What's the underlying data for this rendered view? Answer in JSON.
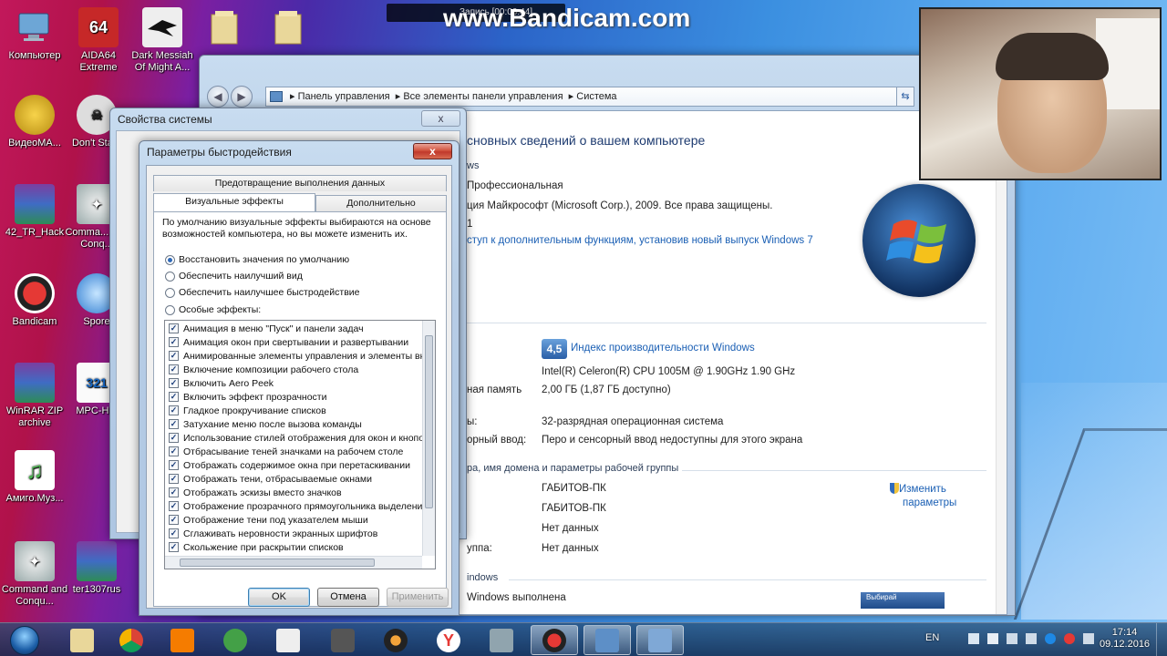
{
  "recorder": {
    "watermark": "www.Bandicam.com",
    "toolbar_text": "Запись [00:00:44]"
  },
  "desktop": {
    "icons": [
      {
        "label": "Компьютер",
        "icon": "computer-icon"
      },
      {
        "label": "AIDA64 Extreme",
        "icon": "aida64-icon"
      },
      {
        "label": "Dark Messiah Of Might A...",
        "icon": "dark-messiah-icon"
      },
      {
        "label": "",
        "icon": "folder-icon"
      },
      {
        "label": "",
        "icon": "folder-icon"
      },
      {
        "label": "ВидеоМА...",
        "icon": "videomaster-icon"
      },
      {
        "label": "Don't Sta...",
        "icon": "dont-starve-icon"
      },
      {
        "label": "42_TR_Hack",
        "icon": "winrar-icon"
      },
      {
        "label": "Comma... and Conq...",
        "icon": "command-conquer-icon"
      },
      {
        "label": "Bandicam",
        "icon": "bandicam-icon"
      },
      {
        "label": "Spore",
        "icon": "spore-icon"
      },
      {
        "label": "WinRAR ZIP archive",
        "icon": "winrar-zip-icon"
      },
      {
        "label": "MPC-H...",
        "icon": "mpc-icon"
      },
      {
        "label": "Амиго.Муз...",
        "icon": "amigo-music-icon"
      },
      {
        "label": "Command and Conqu...",
        "icon": "command-conquer-icon"
      },
      {
        "label": "ter1307rus",
        "icon": "winrar-icon"
      }
    ]
  },
  "system_window": {
    "breadcrumb": [
      "Панель управления",
      "Все элементы панели управления",
      "Система"
    ],
    "heading": "сновных сведений о вашем компьютере",
    "windows_section": "ws",
    "edition": "Профессиональная",
    "copyright": "ция Майкрософт (Microsoft Corp.), 2009. Все права защищены.",
    "sp": "1",
    "upgrade_link": "ступ к дополнительным функциям, установив новый выпуск Windows 7",
    "rating_value": "4,5",
    "rating_link": "Индекс производительности Windows",
    "processor": "Intel(R) Celeron(R) CPU 1005M @ 1.90GHz  1.90 GHz",
    "memory_label": "ная память",
    "memory_value": "2,00 ГБ (1,87 ГБ доступно)",
    "systype_label": "ы:",
    "systype_value": "32-разрядная операционная система",
    "pen_label": "орный ввод:",
    "pen_value": "Перо и сенсорный ввод недоступны для этого экрана",
    "domain_section": "ра, имя домена и параметры рабочей группы",
    "computer_name": "ГАБИТОВ-ПК",
    "full_name": "ГАБИТОВ-ПК",
    "description": "Нет данных",
    "workgroup_label": "уппа:",
    "workgroup": "Нет данных",
    "change_link_1": "Изменить",
    "change_link_2": "параметры",
    "activation_section": "indows",
    "activation_text": "Windows выполнена",
    "activation_button": "Выбирай"
  },
  "system_properties": {
    "title": "Свойства системы",
    "close": "x"
  },
  "performance_dialog": {
    "title": "Параметры быстродействия",
    "close": "x",
    "tabs": {
      "dep": "Предотвращение выполнения данных",
      "visual": "Визуальные эффекты",
      "advanced": "Дополнительно"
    },
    "description": "По умолчанию визуальные эффекты выбираются на основе возможностей компьютера, но вы можете изменить их.",
    "radios": [
      {
        "label": "Восстановить значения по умолчанию",
        "selected": true
      },
      {
        "label": "Обеспечить наилучший вид",
        "selected": false
      },
      {
        "label": "Обеспечить наилучшее быстродействие",
        "selected": false
      },
      {
        "label": "Особые эффекты:",
        "selected": false
      }
    ],
    "effects": [
      "Анимация в меню \"Пуск\" и панели задач",
      "Анимация окон при свертывании и развертывании",
      "Анимированные элементы управления и элементы вну",
      "Включение композиции рабочего стола",
      "Включить Aero Peek",
      "Включить эффект прозрачности",
      "Гладкое прокручивание списков",
      "Затухание меню после вызова команды",
      "Использование стилей отображения для окон и кнопо",
      "Отбрасывание теней значками на рабочем столе",
      "Отображать содержимое окна при перетаскивании",
      "Отображать тени, отбрасываемые окнами",
      "Отображать эскизы вместо значков",
      "Отображение прозрачного прямоугольника выделени",
      "Отображение тени под указателем мыши",
      "Сглаживать неровности экранных шрифтов",
      "Скольжение при раскрытии списков"
    ],
    "buttons": {
      "ok": "OK",
      "cancel": "Отмена",
      "apply": "Применить"
    }
  },
  "taskbar": {
    "items": [
      "start-orb-icon",
      "explorer-folder-icon",
      "chrome-icon",
      "media-player-icon",
      "podcast-icon",
      "dark-messiah-icon",
      "world-of-tanks-icon",
      "game-icon",
      "yandex-icon",
      "keyboard-icon",
      "bandicam-icon",
      "control-panel-icon",
      "system-properties-icon"
    ],
    "language": "EN",
    "time": "17:14",
    "date": "09.12.2016"
  },
  "colors": {
    "accent": "#1a5fb4",
    "close_red": "#c0392b"
  }
}
